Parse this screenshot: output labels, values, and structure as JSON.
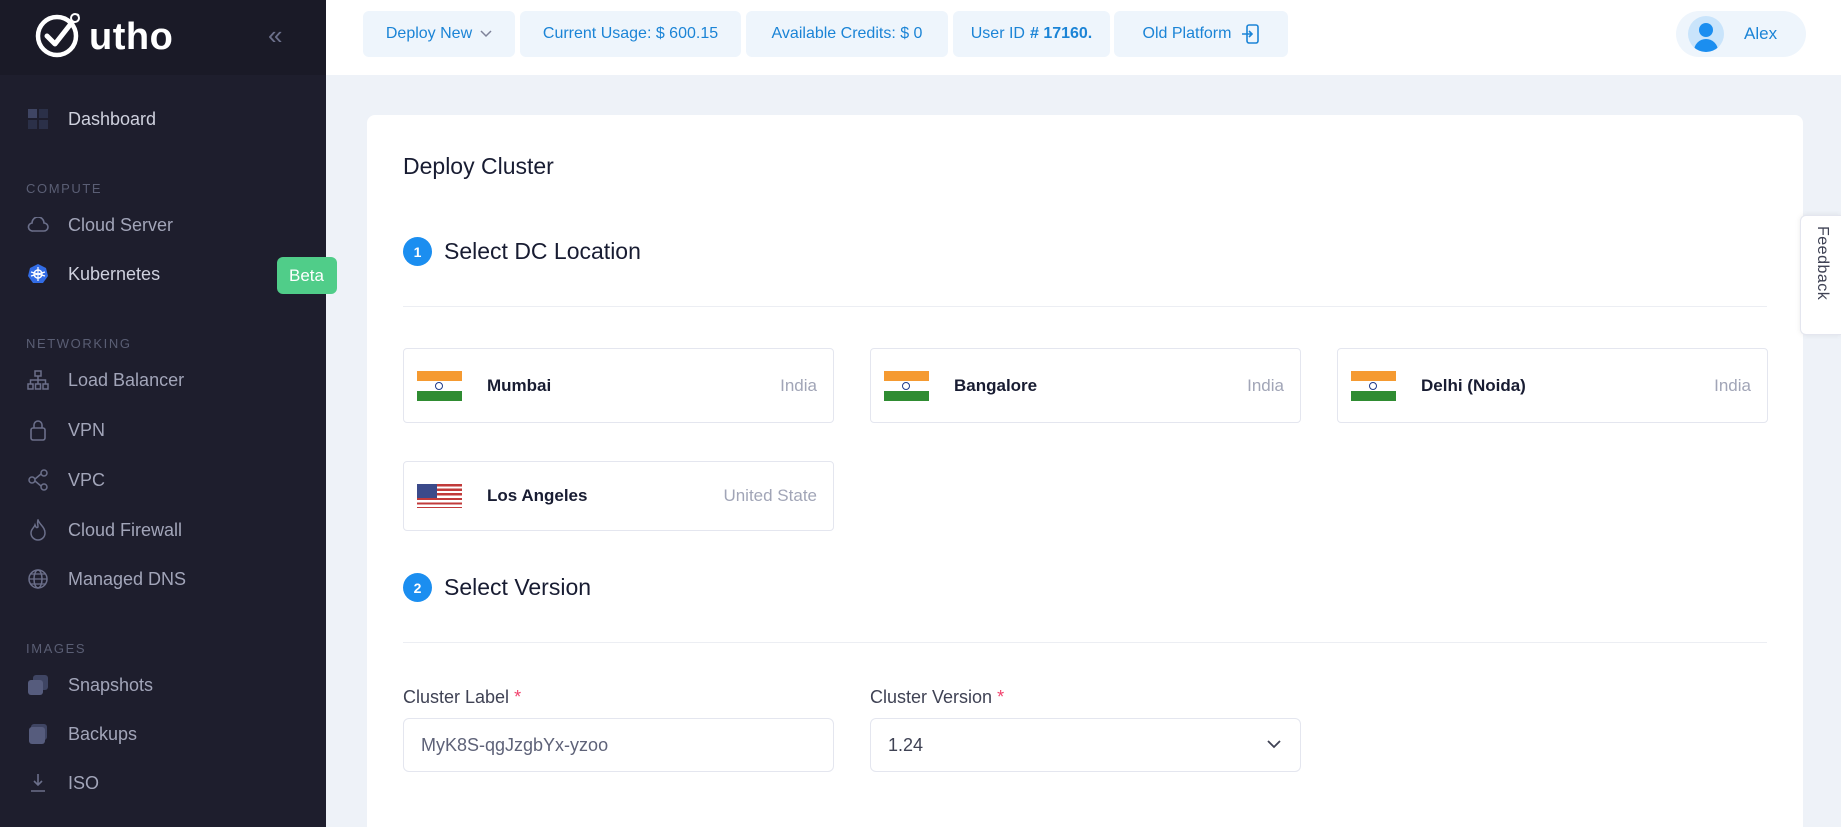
{
  "brand": {
    "name": "utho"
  },
  "sidebar": {
    "dashboard": "Dashboard",
    "sections": {
      "compute": "COMPUTE",
      "networking": "NETWORKING",
      "images": "IMAGES"
    },
    "items": {
      "cloud_server": "Cloud Server",
      "kubernetes": "Kubernetes",
      "load_balancer": "Load Balancer",
      "vpn": "VPN",
      "vpc": "VPC",
      "cloud_firewall": "Cloud Firewall",
      "managed_dns": "Managed DNS",
      "snapshots": "Snapshots",
      "backups": "Backups",
      "iso": "ISO"
    },
    "beta_badge": "Beta"
  },
  "topbar": {
    "deploy_new": "Deploy New",
    "current_usage": "Current Usage: $ 600.15",
    "available_credits": "Available Credits: $ 0",
    "user_id_label": "User ID",
    "user_id_value": "# 17160.",
    "old_platform": "Old Platform",
    "user_name": "Alex"
  },
  "page": {
    "title": "Deploy Cluster",
    "step1": {
      "num": "1",
      "label": "Select DC Location"
    },
    "step2": {
      "num": "2",
      "label": "Select Version"
    },
    "locations": [
      {
        "city": "Mumbai",
        "country": "India",
        "flag": "india-flag"
      },
      {
        "city": "Bangalore",
        "country": "India",
        "flag": "india-flag"
      },
      {
        "city": "Delhi (Noida)",
        "country": "India",
        "flag": "india-flag"
      },
      {
        "city": "Los Angeles",
        "country": "United State",
        "flag": "usa-flag"
      }
    ],
    "cluster_label": {
      "label": "Cluster Label",
      "required": "*",
      "value": "MyK8S-qgJzgbYx-yzoo"
    },
    "cluster_version": {
      "label": "Cluster Version",
      "required": "*",
      "value": "1.24"
    }
  },
  "feedback": "Feedback",
  "colors": {
    "accent": "#1b8ef0",
    "sidebar_bg": "#1e1e2d",
    "beta": "#50cd89",
    "required": "#f1416c"
  }
}
